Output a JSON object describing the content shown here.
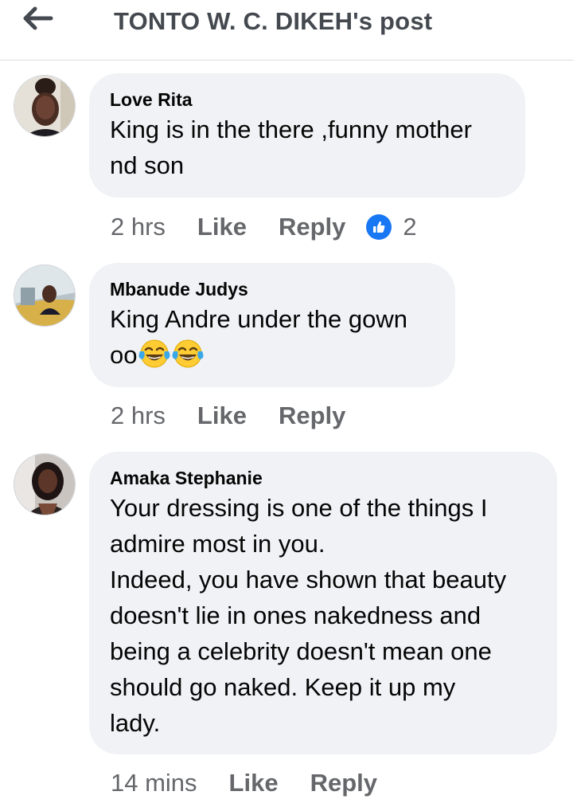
{
  "header": {
    "title": "TONTO W. C. DIKEH's post"
  },
  "comments": [
    {
      "author": "Love Rita",
      "text": "King is in the there ,funny mother\nnd son",
      "time": "2 hrs",
      "like_label": "Like",
      "reply_label": "Reply",
      "reaction_count": "2"
    },
    {
      "author": "Mbanude Judys",
      "text_line1": "King Andre under the gown",
      "text_line2": "oo",
      "time": "2 hrs",
      "like_label": "Like",
      "reply_label": "Reply"
    },
    {
      "author": "Amaka Stephanie",
      "text": "Your dressing is one of the things I\nadmire most in you.\nIndeed, you have shown that beauty\ndoesn't lie in ones nakedness and\nbeing a celebrity doesn't mean one\nshould go naked. Keep it up my\nlady.",
      "time": "14 mins",
      "like_label": "Like",
      "reply_label": "Reply"
    }
  ],
  "icons": {
    "back": "arrow-left-icon",
    "reaction": "thumbs-up-icon",
    "emoji": "tears-of-joy-emoji"
  },
  "colors": {
    "bubble": "#f0f2f5",
    "like_blue": "#1877f2",
    "meta_gray": "#65676b"
  }
}
